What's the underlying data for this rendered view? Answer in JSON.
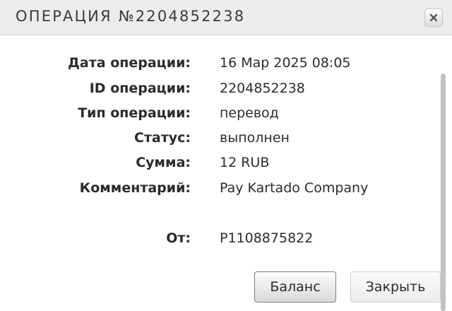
{
  "dialog": {
    "title": "ОПЕРАЦИЯ №2204852238",
    "close_icon": "close-icon"
  },
  "details": {
    "date_label": "Дата операции:",
    "date_value": "16 Мар 2025 08:05",
    "id_label": "ID операции:",
    "id_value": "2204852238",
    "type_label": "Тип операции:",
    "type_value": "перевод",
    "status_label": "Статус:",
    "status_value": "выполнен",
    "amount_label": "Сумма:",
    "amount_value": "12 RUB",
    "comment_label": "Комментарий:",
    "comment_value": "Pay Kartado Company",
    "from_label": "От:",
    "from_value": "P1108875822"
  },
  "buttons": {
    "balance_label": "Баланс",
    "close_label": "Закрыть"
  }
}
